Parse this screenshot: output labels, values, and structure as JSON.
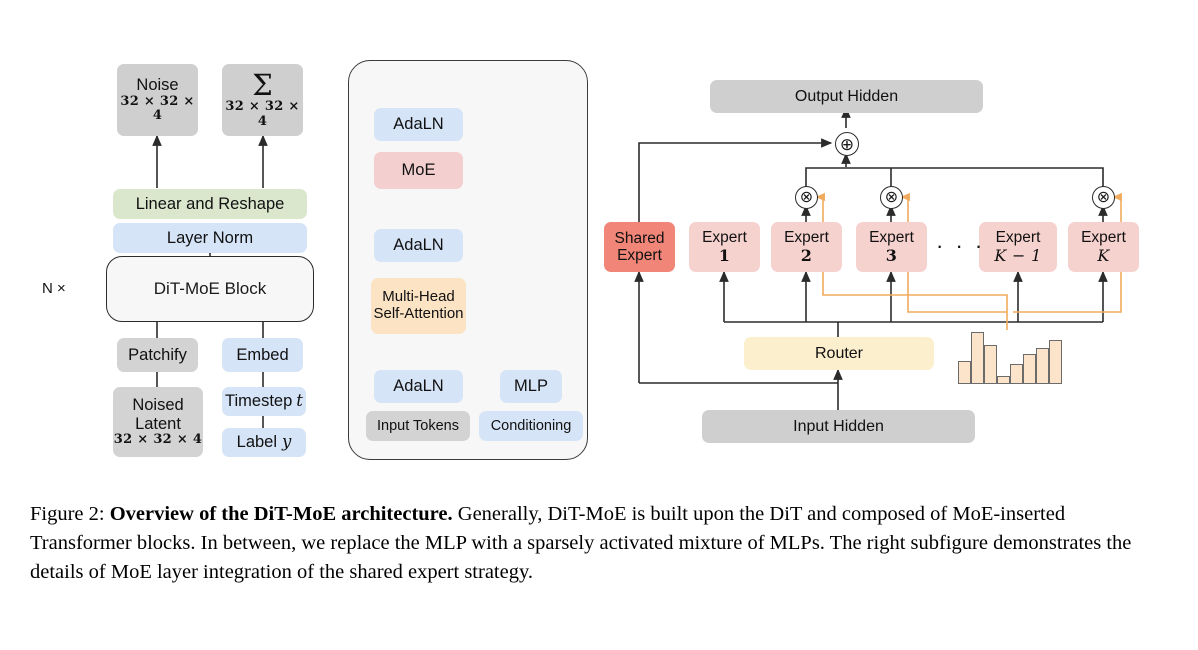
{
  "figure": {
    "caption_label": "Figure 2:",
    "caption_bold": "Overview of the DiT-MoE architecture.",
    "caption_rest": " Generally, DiT-MoE is built upon the DiT and composed of MoE-inserted Transformer blocks. In between, we replace the MLP with a sparsely activated mixture of MLPs. The right subfigure demonstrates the details of MoE layer integration of the shared expert strategy."
  },
  "left_panel": {
    "noise": {
      "label": "Noise",
      "dims": "32 × 32 × 4"
    },
    "sigma": {
      "label": "Σ",
      "dims": "32 × 32 × 4"
    },
    "linear_reshape": "Linear and Reshape",
    "layer_norm": "Layer Norm",
    "dit_block": "DiT-MoE Block",
    "repeat_label": "N ×",
    "patchify": "Patchify",
    "embed": "Embed",
    "noised_latent": {
      "line1": "Noised",
      "line2": "Latent",
      "dims": "32 × 32 × 4"
    },
    "timestep": "Timestep",
    "timestep_var": "t",
    "label_box": "Label",
    "label_var": "y"
  },
  "mid_panel": {
    "adaln_top": "AdaLN",
    "moe": "MoE",
    "adaln_mid": "AdaLN",
    "attention": {
      "line1": "Multi-Head",
      "line2": "Self-Attention"
    },
    "adaln_bottom": "AdaLN",
    "mlp": "MLP",
    "input_tokens": "Input Tokens",
    "conditioning": "Conditioning"
  },
  "right_panel": {
    "output_hidden": "Output Hidden",
    "input_hidden": "Input Hidden",
    "router": "Router",
    "ellipsis": "· · ·",
    "add_symbol": "⊕",
    "mul_symbol": "⊗",
    "experts": [
      {
        "line1": "Shared",
        "line2": "Expert",
        "kind": "shared",
        "gated": false
      },
      {
        "line1": "Expert",
        "line2": "1",
        "kind": "expert",
        "gated": false
      },
      {
        "line1": "Expert",
        "line2": "2",
        "kind": "expert",
        "gated": true
      },
      {
        "line1": "Expert",
        "line2": "3",
        "kind": "expert",
        "gated": true
      },
      {
        "line1": "Expert",
        "line2": "K − 1",
        "kind": "expert",
        "gated": false
      },
      {
        "line1": "Expert",
        "line2": "K",
        "kind": "expert",
        "gated": true
      }
    ],
    "router_histogram": {
      "values": [
        0.45,
        1.0,
        0.75,
        0.15,
        0.38,
        0.58,
        0.7,
        0.85
      ]
    }
  },
  "colors": {
    "gray": "#cfcfcf",
    "blue": "#d6e4f7",
    "green": "#dbe7cd",
    "pink": "#f3cfcf",
    "orange": "#fce3c4",
    "yellow": "#fcefcd",
    "expert": "#f6d2cf",
    "shared": "#f08578",
    "router_line": "#f0ab5e",
    "wire": "#2b2b2b"
  }
}
